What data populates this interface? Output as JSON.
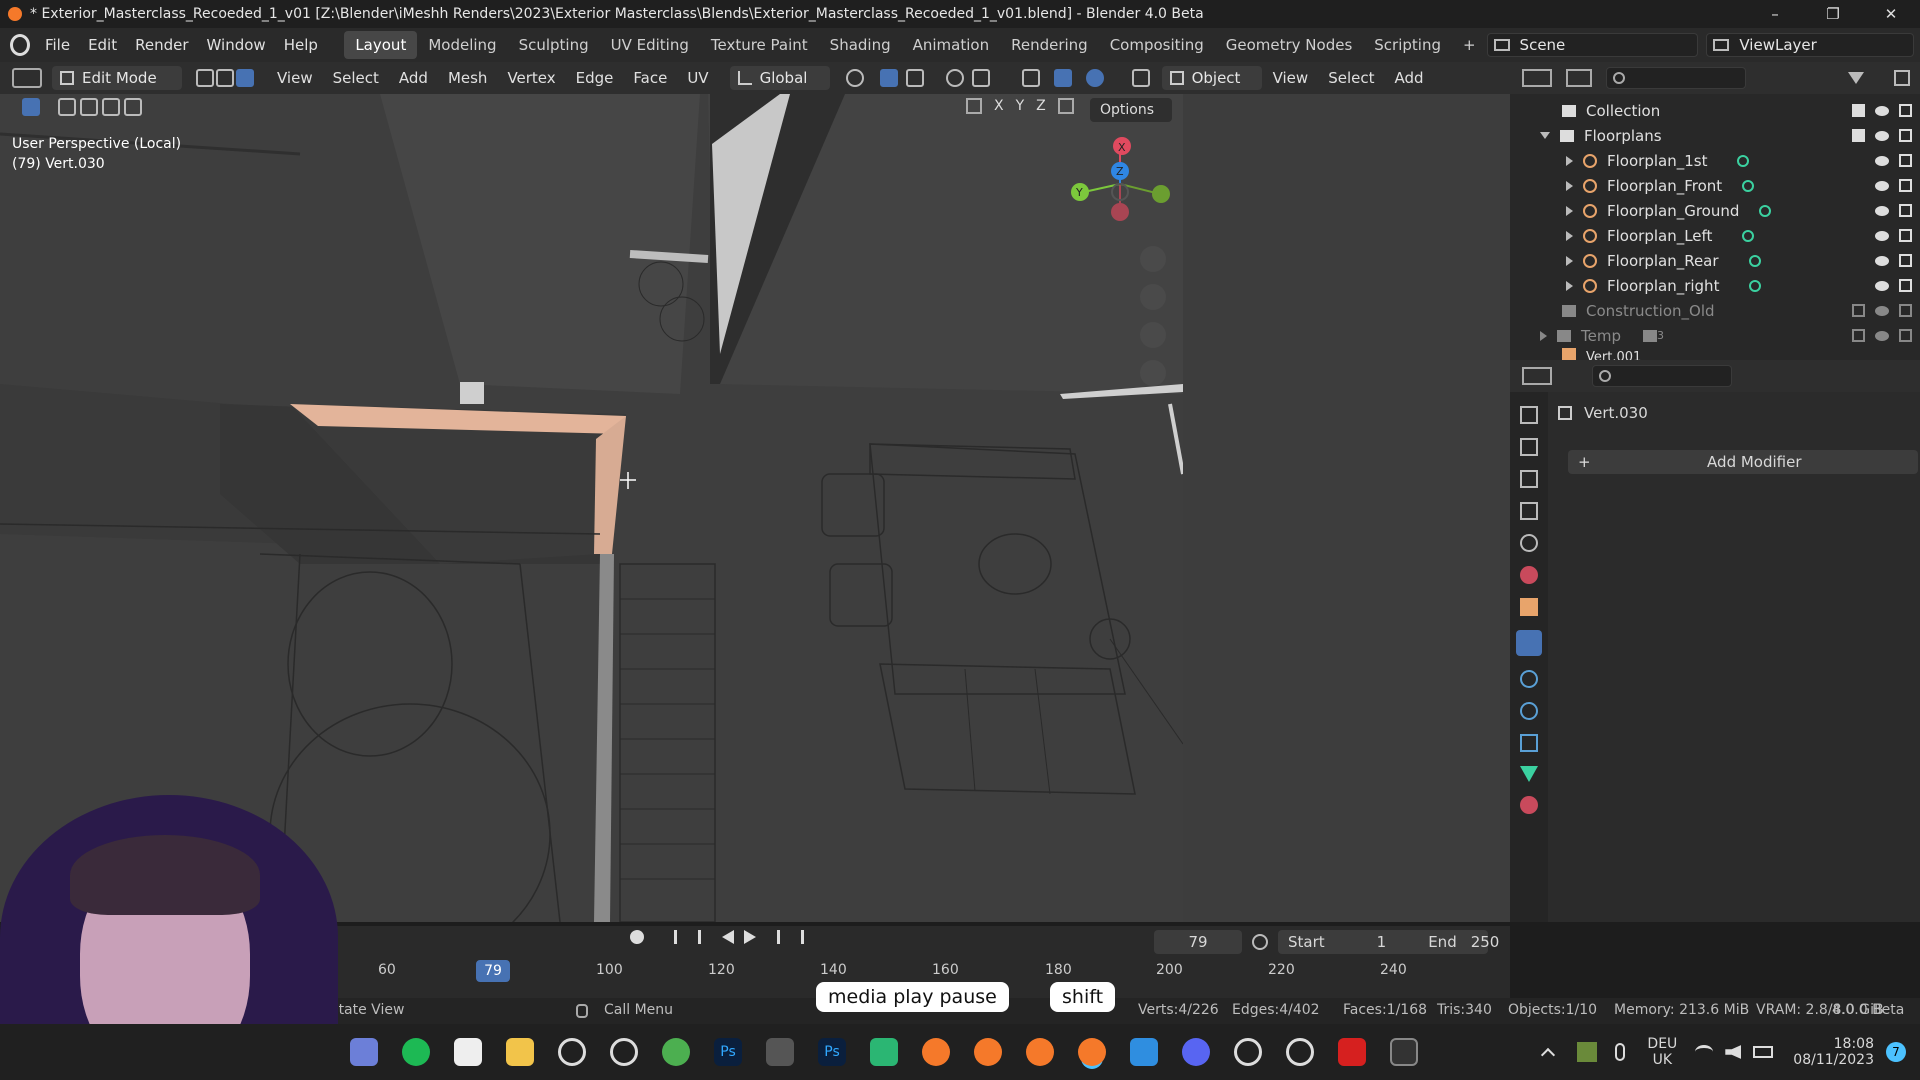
{
  "window": {
    "title": "* Exterior_Masterclass_Recoeded_1_v01 [Z:\\Blender\\iMeshh Renders\\2023\\Exterior Masterclass\\Blends\\Exterior_Masterclass_Recoeded_1_v01.blend] - Blender 4.0 Beta",
    "controls": [
      "–",
      "❐",
      "✕"
    ]
  },
  "menu": {
    "items": [
      "File",
      "Edit",
      "Render",
      "Window",
      "Help"
    ],
    "workspaces": [
      "Layout",
      "Modeling",
      "Sculpting",
      "UV Editing",
      "Texture Paint",
      "Shading",
      "Animation",
      "Rendering",
      "Compositing",
      "Geometry Nodes",
      "Scripting"
    ],
    "add_tab": "+",
    "scene": "Scene",
    "view_layer": "ViewLayer"
  },
  "header": {
    "mode": "Edit Mode",
    "menus": [
      "View",
      "Select",
      "Add",
      "Mesh",
      "Vertex",
      "Edge",
      "Face",
      "UV"
    ],
    "transform": "Global",
    "shading_object": "Object",
    "right_menus": [
      "View",
      "Select",
      "Add"
    ]
  },
  "viewport": {
    "perspective": "User Perspective (Local)",
    "object": "(79) Vert.030",
    "axes": [
      "X",
      "Y",
      "Z"
    ],
    "options": "Options",
    "gizmo": {
      "x": "X",
      "y": "Y",
      "z": "Z"
    }
  },
  "outliner": {
    "collection": "Collection",
    "floorplans": "Floorplans",
    "children": [
      "Floorplan_1st",
      "Floorplan_Front",
      "Floorplan_Ground",
      "Floorplan_Left",
      "Floorplan_Rear",
      "Floorplan_right"
    ],
    "construction": "Construction_Old",
    "temp": "Temp",
    "temp_count": "3",
    "next": "Vert.001"
  },
  "properties": {
    "object": "Vert.030",
    "add_modifier": "Add Modifier"
  },
  "timeline": {
    "current_frame": "79",
    "start_label": "Start",
    "start": "1",
    "end_label": "End",
    "end": "250",
    "ticks": [
      "60",
      "79",
      "100",
      "120",
      "140",
      "160",
      "180",
      "200",
      "220",
      "240"
    ]
  },
  "status": {
    "rotate": "otate View",
    "call_menu": "Call Menu",
    "verts": "Verts:4/226",
    "edges": "Edges:4/402",
    "faces": "Faces:1/168",
    "tris": "Tris:340",
    "objects": "Objects:1/10",
    "memory": "Memory: 213.6 MiB",
    "vram": "VRAM: 2.8/8.0 GiB",
    "version": "4.0.0 Beta"
  },
  "keys": {
    "media": "media play pause",
    "shift": "shift"
  },
  "taskbar": {
    "lang": "DEU",
    "region": "UK",
    "time": "18:08",
    "date": "08/11/2023",
    "badge": "7",
    "icons": [
      "files-icon",
      "spotify-icon",
      "notion-icon",
      "explorer-icon",
      "sync-icon",
      "chrome-dev-icon",
      "chrome-icon",
      "photoshop-icon",
      "app-icon",
      "photoshop2-icon",
      "green-app-icon",
      "blender1-icon",
      "blender2-icon",
      "blender3-icon",
      "blender4-icon",
      "vscode-icon",
      "discord-icon",
      "chatgpt-icon",
      "app-icon-2",
      "acrobat-icon",
      "terminal-icon"
    ]
  },
  "colors": {
    "accent": "#4772b3",
    "selected_face": "#e3b49a",
    "current_frame": "#4772b3"
  }
}
